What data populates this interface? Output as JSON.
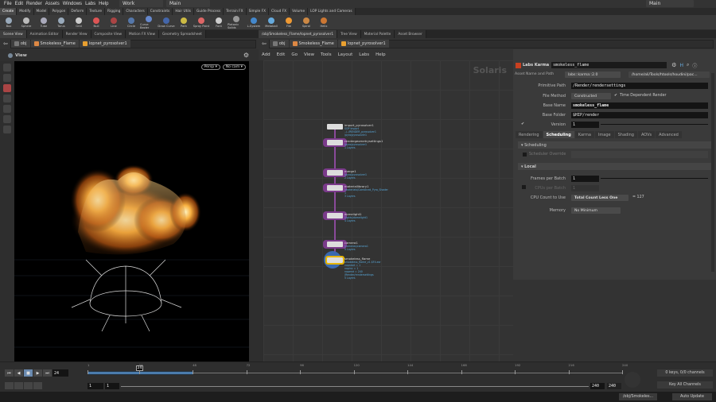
{
  "menubar": {
    "items": [
      "File",
      "Edit",
      "Render",
      "Assets",
      "Windows",
      "Labs",
      "Help"
    ],
    "desktop": "Work",
    "context": "Main",
    "context_right": "Main"
  },
  "shelf": {
    "tabs": [
      "Create",
      "Modify",
      "Model",
      "Polygon",
      "Deform",
      "Texture",
      "Rigging",
      "Characters",
      "Constraints",
      "Hair Utils",
      "Guide Process",
      "Terrain FX",
      "Simple FX",
      "Cloud FX",
      "Volume",
      "LOP Lights and Cameras"
    ],
    "tools": [
      {
        "label": "Box",
        "color": "#9ab"
      },
      {
        "label": "Sphere",
        "color": "#bbb"
      },
      {
        "label": "Tube",
        "color": "#aab"
      },
      {
        "label": "Torus",
        "color": "#9ab"
      },
      {
        "label": "Grid",
        "color": "#ccc"
      },
      {
        "label": "Null",
        "color": "#d55"
      },
      {
        "label": "Line",
        "color": "#a44"
      },
      {
        "label": "Circle",
        "color": "#57a"
      },
      {
        "label": "Curve Bezier",
        "color": "#68c"
      },
      {
        "label": "Draw Curve",
        "color": "#46a"
      },
      {
        "label": "Path",
        "color": "#cb4"
      },
      {
        "label": "Spray Paint",
        "color": "#d66"
      },
      {
        "label": "Font",
        "color": "#ccc"
      },
      {
        "label": "Platonic Solids",
        "color": "#999"
      },
      {
        "label": "L-System",
        "color": "#48c"
      },
      {
        "label": "Metaball",
        "color": "#6ad"
      },
      {
        "label": "File",
        "color": "#e93"
      },
      {
        "label": "Spiral",
        "color": "#c84"
      },
      {
        "label": "Helix",
        "color": "#c73"
      }
    ]
  },
  "left_pane": {
    "tabs": [
      "Scene View",
      "Animation Editor",
      "Render View",
      "Composite View",
      "Motion FX View",
      "Geometry Spreadsheet"
    ],
    "path": [
      "obj",
      "Smokeless_Flame",
      "lopnet_pyrosolver1"
    ],
    "view_label": "View",
    "persp": "Persp",
    "camera": "No cam"
  },
  "net_pane": {
    "tabs": [
      "/obj/Smokeless_Flame/lopnet_pyrosolver1",
      "Tree View",
      "Material Palette",
      "Asset Browser"
    ],
    "path": [
      "obj",
      "Smokeless_Flame",
      "lopnet_pyrosolver1"
    ],
    "menu": [
      "Add",
      "Edit",
      "Go",
      "View",
      "Tools",
      "Layout",
      "Labs",
      "Help"
    ],
    "context_label": "Solaris",
    "nodes": [
      {
        "name": "import_pyrosolver1",
        "info": "SOP Import\n../../RENDER_pyrosolver1\n/pyro/pyrosolver1",
        "halo": false
      },
      {
        "name": "rendergeometrysettings1",
        "info": "/pyro/pyrosolver1\n1 Layers",
        "halo": true
      },
      {
        "name": "merge1",
        "info": "/pyro/pyrosolver1\n2 Layers",
        "halo": true
      },
      {
        "name": "materiallibrary1",
        "info": "/materials/Combined_Pyro_Shader\n1\n3 Layers",
        "halo": true
      },
      {
        "name": "domelight1",
        "info": "/lights/domelight1\n4 Layers",
        "halo": true
      },
      {
        "name": "camera1",
        "info": "/cameras/camera1\n5 Layers",
        "halo": true
      },
      {
        "name": "smokeless_flame",
        "info": "smokeless_flame_v1.$F4.exr\nnopstart = 1\nnopinc = 1\nnopend = 240\n/Render/rendersettings\n5 Layers",
        "halo": true,
        "selected": true
      }
    ]
  },
  "params": {
    "node_type": "Labs Karma",
    "node_name": "smokeless_flame",
    "asset_label": "Asset Name and Path",
    "asset_name": "labs::karma::2.0",
    "asset_path": "/home/ali/Tools/htools/houdini/pac...",
    "fields": {
      "primitive_path_label": "Primitive Path",
      "primitive_path": "/Render/rendersettings",
      "file_method_label": "File Method",
      "file_method": "Constructed",
      "time_dependent": "Time Dependent Render",
      "base_name_label": "Base Name",
      "base_name": "smokeless_flame",
      "base_folder_label": "Base Folder",
      "base_folder": "$HIP/render",
      "version_label": "Version",
      "version": "1"
    },
    "tabs": [
      "Rendering",
      "Scheduling",
      "Karma",
      "Image",
      "Shading",
      "AOVs",
      "Advanced"
    ],
    "active_tab": "Scheduling",
    "scheduling": {
      "title": "Scheduling",
      "scheduler_override": "Scheduler Override"
    },
    "local": {
      "title": "Local",
      "frames_per_batch_label": "Frames per Batch",
      "frames_per_batch": "1",
      "cpus_per_batch_label": "CPUs per Batch",
      "cpus_per_batch": "1",
      "cpu_count_label": "CPU Count to Use",
      "cpu_count": "Total Count Less One",
      "cpu_count_value": "= 127",
      "memory_label": "Memory",
      "memory": "No Minimum"
    }
  },
  "timeline": {
    "current_frame": "24",
    "ticks": [
      "1",
      "24",
      "48",
      "72",
      "96",
      "120",
      "144",
      "168",
      "192",
      "216",
      "240"
    ],
    "start": "1",
    "start2": "1",
    "end": "240",
    "end2": "240",
    "playback_range_end": 48,
    "keys": "0 keys, 0/0 channels",
    "key_all": "Key All Channels"
  },
  "status": {
    "path": "/obj/Smokeles...",
    "update": "Auto Update"
  },
  "colors": {
    "accent": "#2a7fd4",
    "node_halo": "#7a3a8a",
    "selected": "#e6b400",
    "flame": "#f0a030"
  }
}
